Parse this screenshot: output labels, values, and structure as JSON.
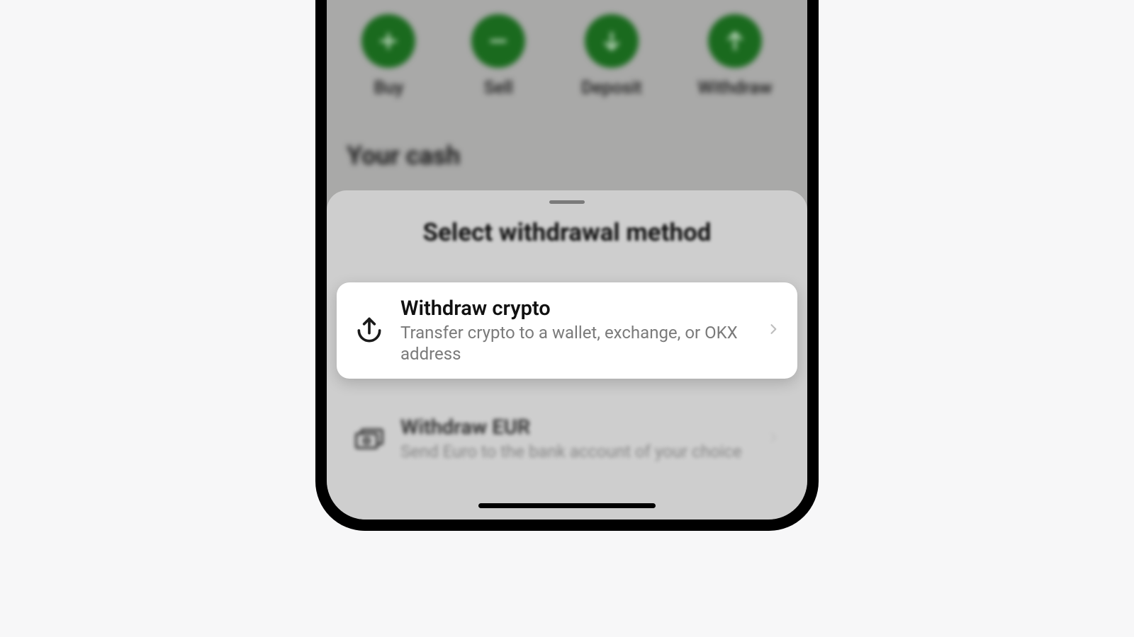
{
  "colors": {
    "accent": "#1a6a1e"
  },
  "actions": {
    "buy": {
      "label": "Buy",
      "icon": "plus-icon"
    },
    "sell": {
      "label": "Sell",
      "icon": "minus-icon"
    },
    "deposit": {
      "label": "Deposit",
      "icon": "arrow-down-icon"
    },
    "withdraw": {
      "label": "Withdraw",
      "icon": "arrow-up-icon"
    }
  },
  "section": {
    "title": "Your cash"
  },
  "sheet": {
    "title": "Select withdrawal method",
    "options": [
      {
        "title": "Withdraw crypto",
        "subtitle": "Transfer crypto to a wallet, exchange, or OKX address",
        "icon": "withdraw-crypto-icon",
        "focused": true
      },
      {
        "title": "Withdraw EUR",
        "subtitle": "Send Euro to the bank account of your choice",
        "icon": "cash-icon",
        "focused": false
      }
    ]
  }
}
